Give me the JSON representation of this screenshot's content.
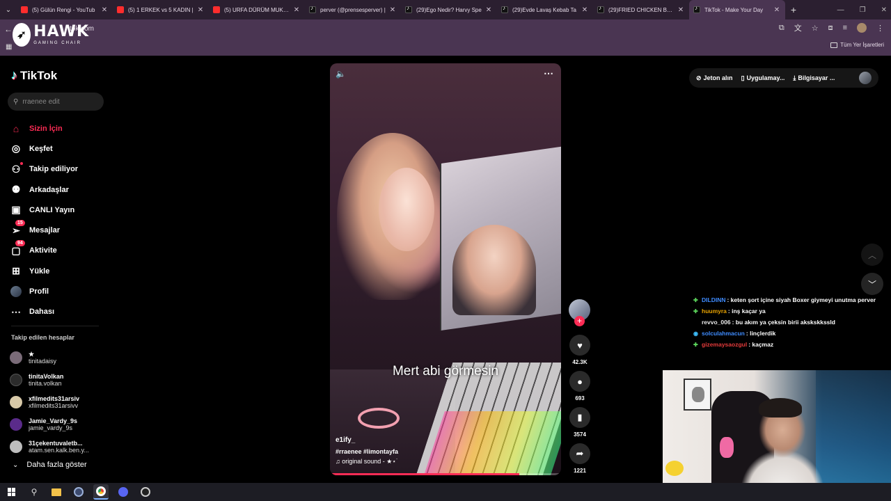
{
  "browser": {
    "tabs": [
      {
        "title": "(5) Gülün Rengi - YouTub",
        "favicon": "youtube-icon"
      },
      {
        "title": "(5) 1 ERKEK vs 5 KADIN |",
        "favicon": "youtube-icon"
      },
      {
        "title": "(5) URFA DÜRÜM MUKBA",
        "favicon": "youtube-icon"
      },
      {
        "title": "perver (@prensesperver) |",
        "favicon": "tiktok-icon"
      },
      {
        "title": "(29)Ego Nedir? Harvy Spe",
        "favicon": "tiktok-icon"
      },
      {
        "title": "(29)Evde Lavaş Kebab Ta",
        "favicon": "tiktok-icon"
      },
      {
        "title": "(29)FRIED CHICKEN BUN",
        "favicon": "tiktok-icon"
      },
      {
        "title": "TikTok - Make Your Day",
        "favicon": "tiktok-icon",
        "active": true
      }
    ],
    "url": "tok.com",
    "bookmarks_label": "Tüm Yer İşaretleri"
  },
  "overlay_logo": {
    "name": "HAWK",
    "subtitle": "GAMING CHAIR"
  },
  "tiktok": {
    "brand": "TikTok",
    "search_placeholder": "rraenee edit",
    "nav": [
      {
        "label": "Sizin İçin",
        "icon": "home-icon",
        "active": true
      },
      {
        "label": "Keşfet",
        "icon": "compass-icon"
      },
      {
        "label": "Takip ediliyor",
        "icon": "following-icon"
      },
      {
        "label": "Arkadaşlar",
        "icon": "friends-icon"
      },
      {
        "label": "CANLI Yayın",
        "icon": "live-icon"
      },
      {
        "label": "Mesajlar",
        "icon": "messages-icon",
        "badge": "15"
      },
      {
        "label": "Aktivite",
        "icon": "activity-icon",
        "badge": "94"
      },
      {
        "label": "Yükle",
        "icon": "upload-icon"
      },
      {
        "label": "Profil",
        "icon": "profile-avatar"
      },
      {
        "label": "Dahası",
        "icon": "more-icon"
      }
    ],
    "following_title": "Takip edilen hesaplar",
    "following": [
      {
        "name": "★",
        "handle": "tinitadaisy",
        "color": "#7a6b78"
      },
      {
        "name": "tinitaVolkan",
        "handle": "tinita.volkan",
        "color": "#2b2b2b"
      },
      {
        "name": "xfilmedits31arsiv",
        "handle": "xfilmedits31arsivv",
        "color": "#d8c9a8"
      },
      {
        "name": "Jamie_Vardy_9s",
        "handle": "jamie_vardy_9s",
        "color": "#5a2b8a"
      },
      {
        "name": "31çekentuvaletb...",
        "handle": "atam.sen.kalk.ben.y...",
        "color": "#bdbdbd"
      }
    ],
    "see_more": "Daha fazla göster"
  },
  "video": {
    "caption": "Mert abi görmesin",
    "username": "e1ify_",
    "tags": "#rraenee  #limontayfa",
    "sound": "original sound - ★⋆˙",
    "progress": 0.82,
    "likes": "42.3K",
    "comments": "693",
    "saves": "3574",
    "shares": "1221"
  },
  "top_right": {
    "coins": "Jeton alın",
    "app": "Uygulamay...",
    "desktop": "Bilgisayar ..."
  },
  "stream_chat": [
    {
      "badge": "✚",
      "user": "DILDINN",
      "color": "#3f8cff",
      "msg": ": keten şort içine siyah Boxer giymeyi unutma perver"
    },
    {
      "badge": "✚",
      "user": "huumyra",
      "color": "#e9a300",
      "msg": ": inş kaçar ya"
    },
    {
      "badge": "",
      "user": "revvo_006",
      "color": "#e8e8e8",
      "msg": ": bu akım ya çeksin birii akskskkssld"
    },
    {
      "badge": "◉",
      "user": "solculahmacun",
      "color": "#3f8cff",
      "msg": ": linçlerdik"
    },
    {
      "badge": "✚",
      "user": "gizemaysaozgul",
      "color": "#e43a3a",
      "msg": ": kaçmaz"
    }
  ]
}
